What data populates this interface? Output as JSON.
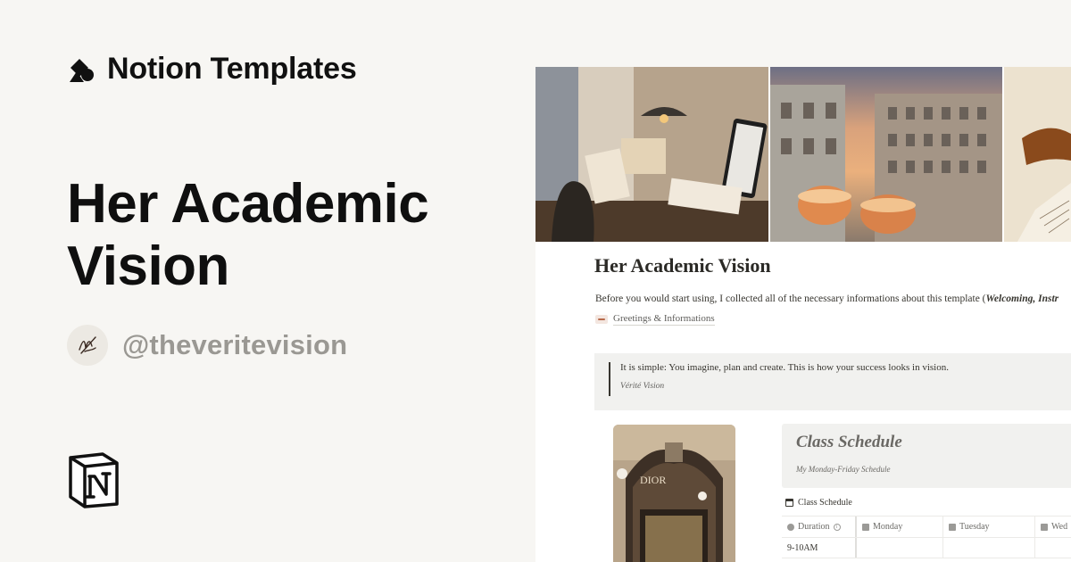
{
  "brand": {
    "name": "Notion Templates",
    "icon": "shapes-icon"
  },
  "template": {
    "title": "Her Academic Vision",
    "author_handle": "@theveritevision",
    "avatar_icon": "signature-avatar"
  },
  "footer": {
    "logo": "notion-logo-icon"
  },
  "preview": {
    "page_title": "Her Academic Vision",
    "intro_text": "Before you would start using, I collected all of the necessary informations about this template (",
    "intro_emphasis": "Welcoming, Instr",
    "link_label": "Greetings & Informations",
    "quote": "It is simple: You imagine, plan and create. This is how your success looks in vision.",
    "quote_author": "Vérité Vision",
    "schedule_title": "Class Schedule",
    "schedule_subtitle": "My Monday-Friday Schedule",
    "database_title": "Class Schedule",
    "columns": [
      "Duration",
      "Monday",
      "Tuesday",
      "Wed"
    ],
    "rows": [
      [
        "9-10AM",
        "",
        "",
        ""
      ]
    ],
    "photo_sign": "DIOR"
  },
  "colors": {
    "background": "#f7f6f3",
    "handle": "#9a9893",
    "callout": "#f1f1ef"
  }
}
